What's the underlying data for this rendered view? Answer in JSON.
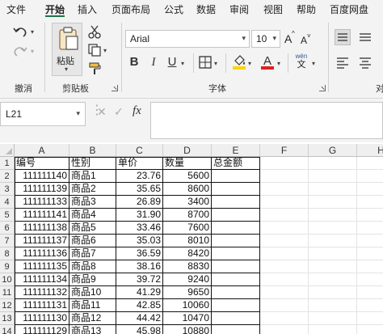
{
  "menu": {
    "items": [
      "文件",
      "开始",
      "插入",
      "页面布局",
      "公式",
      "数据",
      "审阅",
      "视图",
      "帮助",
      "百度网盘"
    ],
    "active": "开始"
  },
  "ribbon": {
    "undo_group_label": "撤消",
    "clipboard": {
      "paste_label": "粘贴",
      "group_label": "剪贴板"
    },
    "font": {
      "name": "Arial",
      "size": "10",
      "group_label": "字体",
      "bold": "B",
      "italic": "I",
      "underline": "U",
      "grow": "A",
      "shrink": "A",
      "font_color_letter": "A",
      "wen_top": "wén",
      "wen_bottom": "文"
    },
    "align_group_label_partial": "对"
  },
  "formula_bar": {
    "name_box": "L21",
    "fx": "fx",
    "value": ""
  },
  "grid": {
    "columns": [
      "A",
      "B",
      "C",
      "D",
      "E",
      "F",
      "G",
      "H"
    ],
    "row_numbers": [
      "1",
      "2",
      "3",
      "4",
      "5",
      "6",
      "7",
      "8",
      "9",
      "10",
      "11",
      "12",
      "13",
      "14"
    ],
    "header_row": [
      "编号",
      "性别",
      "单价",
      "数量",
      "总金额"
    ],
    "rows": [
      [
        "111111140",
        "商品1",
        "23.76",
        "5600",
        ""
      ],
      [
        "111111139",
        "商品2",
        "35.65",
        "8600",
        ""
      ],
      [
        "111111133",
        "商品3",
        "26.89",
        "3400",
        ""
      ],
      [
        "111111141",
        "商品4",
        "31.90",
        "8700",
        ""
      ],
      [
        "111111138",
        "商品5",
        "33.46",
        "7600",
        ""
      ],
      [
        "111111137",
        "商品6",
        "35.03",
        "8010",
        ""
      ],
      [
        "111111136",
        "商品7",
        "36.59",
        "8420",
        ""
      ],
      [
        "111111135",
        "商品8",
        "38.16",
        "8830",
        ""
      ],
      [
        "111111134",
        "商品9",
        "39.72",
        "9240",
        ""
      ],
      [
        "111111132",
        "商品10",
        "41.29",
        "9650",
        ""
      ],
      [
        "111111131",
        "商品11",
        "42.85",
        "10060",
        ""
      ],
      [
        "111111130",
        "商品12",
        "44.42",
        "10470",
        ""
      ],
      [
        "111111129",
        "商品13",
        "45.98",
        "10880",
        ""
      ]
    ]
  },
  "colors": {
    "accent": "#217346",
    "font_color": "#e02020",
    "highlight": "#ffd200"
  },
  "icons": [
    "undo-icon",
    "redo-icon",
    "paste-icon",
    "cut-icon",
    "copy-icon",
    "format-painter-icon",
    "border-icon",
    "fill-color-icon",
    "font-color-icon",
    "phonetic-icon",
    "align-icon",
    "cancel-icon",
    "confirm-icon"
  ]
}
